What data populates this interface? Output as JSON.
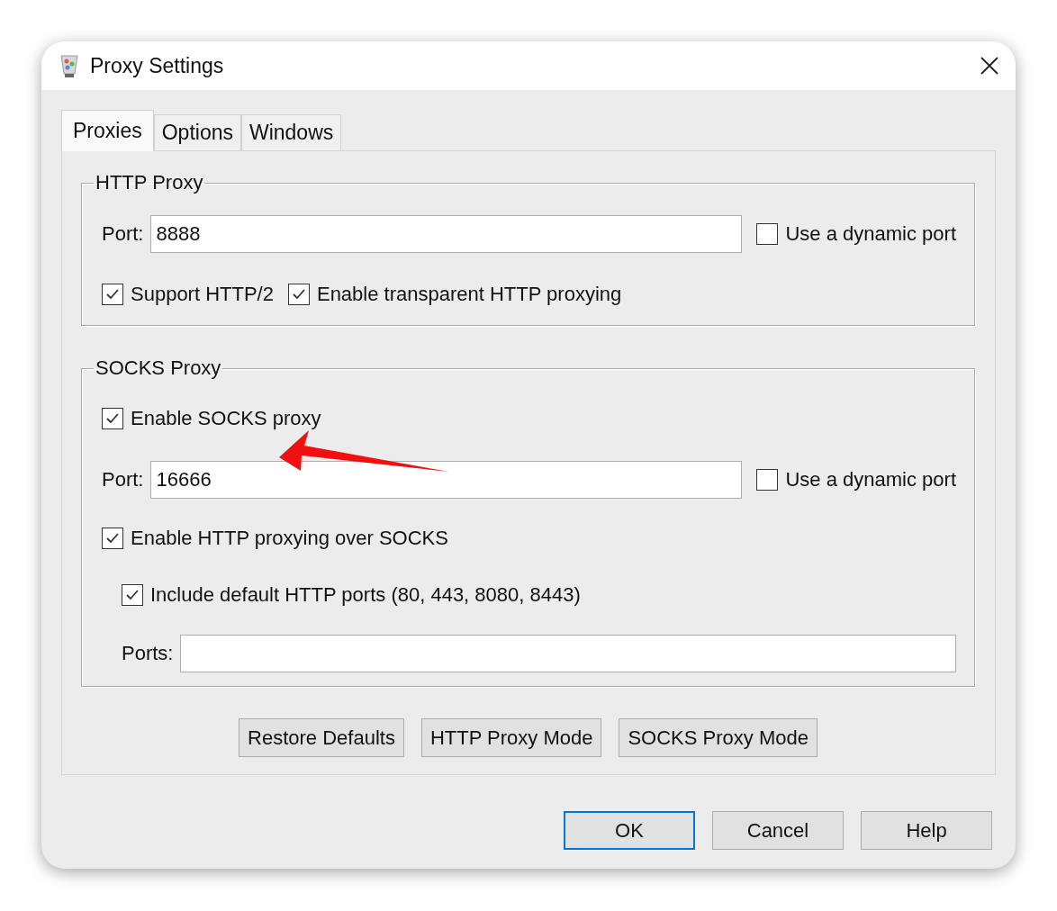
{
  "window": {
    "title": "Proxy Settings"
  },
  "tabs": [
    {
      "label": "Proxies",
      "selected": true
    },
    {
      "label": "Options",
      "selected": false
    },
    {
      "label": "Windows",
      "selected": false
    }
  ],
  "http_proxy": {
    "title": "HTTP Proxy",
    "port_label": "Port:",
    "port": "8888",
    "dynamic_port": {
      "label": "Use a dynamic port",
      "checked": false
    },
    "options": [
      {
        "label": "Support HTTP/2",
        "checked": true
      },
      {
        "label": "Enable transparent HTTP proxying",
        "checked": true
      }
    ]
  },
  "socks_proxy": {
    "title": "SOCKS Proxy",
    "enable": {
      "label": "Enable SOCKS proxy",
      "checked": true
    },
    "port_label": "Port:",
    "port": "16666",
    "dynamic_port": {
      "label": "Use a dynamic port",
      "checked": false
    },
    "http_over_socks": {
      "label": "Enable HTTP proxying over SOCKS",
      "checked": true
    },
    "include_default_ports": {
      "label": "Include default HTTP ports (80, 443, 8080, 8443)",
      "checked": true
    },
    "ports_label": "Ports:"
  },
  "mode_buttons": [
    "Restore Defaults",
    "HTTP Proxy Mode",
    "SOCKS Proxy Mode"
  ],
  "dialog_buttons": [
    {
      "label": "OK",
      "default": true
    },
    {
      "label": "Cancel",
      "default": false
    },
    {
      "label": "Help",
      "default": false
    }
  ]
}
